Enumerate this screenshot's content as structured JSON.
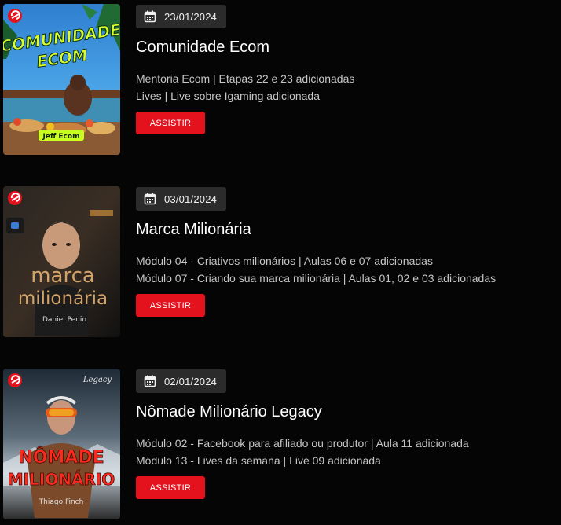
{
  "accent_color": "#e3121d",
  "date_icon": "calendar-icon",
  "entries": [
    {
      "thumbnail": {
        "headline_1": "COMUNIDADE",
        "headline_2": "ECOM",
        "tag": "Jeff Ecom"
      },
      "date": "23/01/2024",
      "title": "Comunidade Ecom",
      "lines": [
        "Mentoria Ecom | Etapas 22 e 23 adicionadas",
        "Lives | Live sobre Igaming adicionada"
      ],
      "button_label": "ASSISTIR"
    },
    {
      "thumbnail": {
        "headline_1": "marca",
        "headline_2": "milionária",
        "tag": "Daniel Penin"
      },
      "date": "03/01/2024",
      "title": "Marca Milionária",
      "lines": [
        "Módulo 04 - Criativos milionários | Aulas 06 e 07 adicionadas",
        "Módulo 07 - Criando sua marca milionária | Aulas 01, 02 e 03 adicionadas"
      ],
      "button_label": "ASSISTIR"
    },
    {
      "thumbnail": {
        "corner": "Legacy",
        "headline_1": "NÔMADE",
        "headline_2": "MILIONÁRIO",
        "tag": "Thiago Finch"
      },
      "date": "02/01/2024",
      "title": "Nômade Milionário Legacy",
      "lines": [
        "Módulo 02 - Facebook para afiliado ou produtor | Aula 11 adicionada",
        "Módulo 13 - Lives da semana | Live 09 adicionada"
      ],
      "button_label": "ASSISTIR"
    }
  ]
}
